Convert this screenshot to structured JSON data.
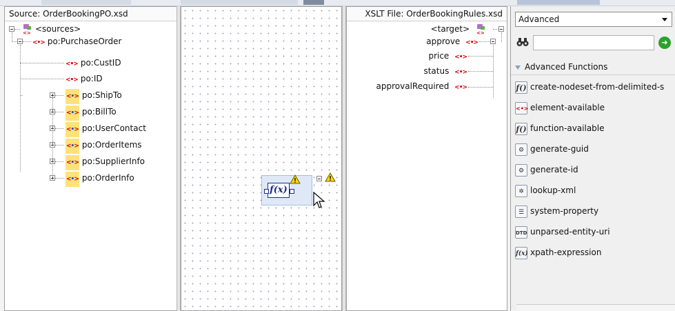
{
  "source": {
    "title": "Source: OrderBookingPO.xsd",
    "root": "<sources>",
    "parent": "po:PurchaseOrder",
    "children": [
      {
        "label": "po:CustID",
        "expandable": false
      },
      {
        "label": "po:ID",
        "expandable": false
      },
      {
        "label": "po:ShipTo",
        "expandable": true
      },
      {
        "label": "po:BillTo",
        "expandable": true
      },
      {
        "label": "po:UserContact",
        "expandable": true
      },
      {
        "label": "po:OrderItems",
        "expandable": true
      },
      {
        "label": "po:SupplierInfo",
        "expandable": true
      },
      {
        "label": "po:OrderInfo",
        "expandable": true
      }
    ]
  },
  "target": {
    "title": "XSLT File: OrderBookingRules.xsd",
    "root": "<target>",
    "parent": "approve",
    "children": [
      "price",
      "status",
      "approvalRequired"
    ]
  },
  "canvas": {
    "function_symbol": "f(x)"
  },
  "palette": {
    "selected_category": "Advanced",
    "section_title": "Advanced Functions",
    "functions": [
      {
        "label": "create-nodeset-from-delimited-s",
        "icon": "function-icon"
      },
      {
        "label": "element-available",
        "icon": "element-icon"
      },
      {
        "label": "function-available",
        "icon": "function-icon"
      },
      {
        "label": "generate-guid",
        "icon": "id-generator-icon"
      },
      {
        "label": "generate-id",
        "icon": "id-generator-icon"
      },
      {
        "label": "lookup-xml",
        "icon": "lookup-icon"
      },
      {
        "label": "system-property",
        "icon": "property-sheet-icon"
      },
      {
        "label": "unparsed-entity-uri",
        "icon": "dtd-icon"
      },
      {
        "label": "xpath-expression",
        "icon": "fx-icon"
      }
    ],
    "dtd_text": "DTD",
    "fx_text": "f(x)",
    "f_text": "f()"
  },
  "colors": {
    "element_red": "#d40000",
    "highlight_yellow": "#ffe27a",
    "canvas_dot": "#9aa3b8",
    "go_green": "#2da12d"
  }
}
